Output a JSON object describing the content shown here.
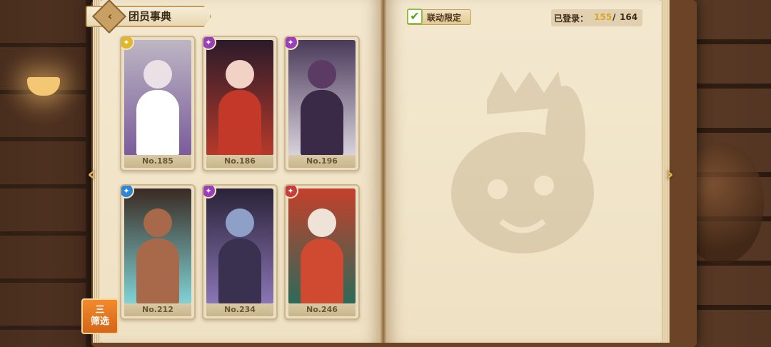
{
  "header": {
    "title": "团员事典",
    "back_icon": "back-arrow-icon"
  },
  "collab": {
    "label": "联动限定",
    "checked": true
  },
  "registered": {
    "label": "已登录：",
    "current": "155",
    "separator": "/",
    "total": "164"
  },
  "filter": {
    "line1": "三",
    "line2": "筛选"
  },
  "cards": [
    {
      "number": "No.185",
      "element": "yellow",
      "element_color": "#e0b62a",
      "art_top": "#bdb6c4",
      "art_bottom": "#7a5c9a",
      "head": "#e9e1e6",
      "body": "#ffffff"
    },
    {
      "number": "No.186",
      "element": "purple",
      "element_color": "#9a3fb8",
      "art_top": "#2b1b2a",
      "art_bottom": "#b53a2a",
      "head": "#f1d2c4",
      "body": "#c2392a"
    },
    {
      "number": "No.196",
      "element": "purple",
      "element_color": "#9a3fb8",
      "art_top": "#4a3a5a",
      "art_bottom": "#d9d3dc",
      "head": "#5b3a63",
      "body": "#3a2a48"
    },
    {
      "number": "No.212",
      "element": "blue",
      "element_color": "#2f86d2",
      "art_top": "#3a2a22",
      "art_bottom": "#7fd4d8",
      "head": "#a8684a",
      "body": "#a8684a"
    },
    {
      "number": "No.234",
      "element": "purple",
      "element_color": "#9a3fb8",
      "art_top": "#2a2238",
      "art_bottom": "#8a77b6",
      "head": "#8fa0c8",
      "body": "#3a3050"
    },
    {
      "number": "No.246",
      "element": "red",
      "element_color": "#c93c3c",
      "art_top": "#c4402a",
      "art_bottom": "#2c6a5a",
      "head": "#efe2d6",
      "body": "#d04a32"
    }
  ],
  "navigation": {
    "prev": "‹",
    "next": "›"
  }
}
